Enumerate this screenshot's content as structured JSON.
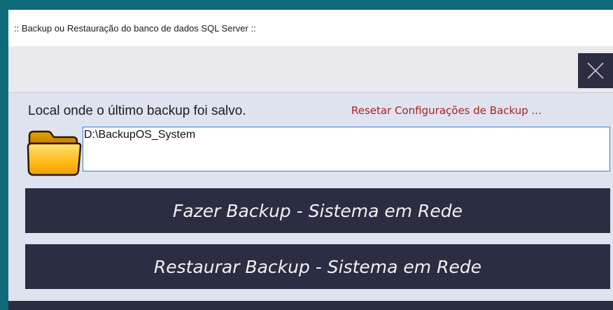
{
  "window": {
    "title": ":: Backup ou Restauração do banco de dados SQL Server ::"
  },
  "toolbar": {
    "close_icon": "close-icon"
  },
  "backup_location": {
    "label": "Local onde o último backup foi salvo.",
    "reset_link": "Resetar Configurações de Backup ...",
    "folder_icon": "folder-icon",
    "path_value": "D:\\BackupOS_System"
  },
  "actions": {
    "backup_label": "Fazer Backup - Sistema em Rede",
    "restore_label": "Restaurar Backup - Sistema em Rede"
  },
  "colors": {
    "button_bg": "#2b2d42",
    "link": "#a8231c",
    "input_border": "#2f80d6",
    "window_bg": "#dfe3ef"
  }
}
